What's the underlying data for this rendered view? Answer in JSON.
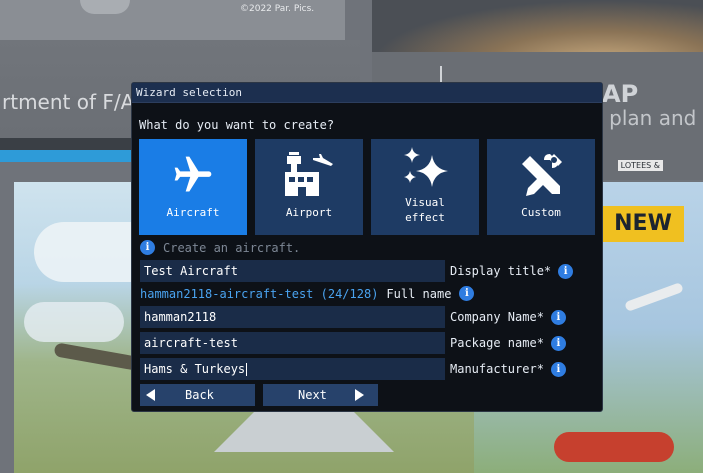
{
  "background": {
    "copyright": "©2022 Par. Pics.",
    "department_text": "rtment of F/A",
    "plan_title": "AP",
    "plan_subtitle": "Create a flight plan and",
    "new_badge": "NEW",
    "sticker": "LOTEES &"
  },
  "dialog": {
    "title": "Wizard selection",
    "question": "What do you want to create?",
    "tiles": [
      {
        "label": "Aircraft",
        "icon": "airplane-icon",
        "selected": true
      },
      {
        "label": "Airport",
        "icon": "airport-icon",
        "selected": false
      },
      {
        "label": "Visual\neffect",
        "icon": "sparkles-icon",
        "selected": false
      },
      {
        "label": "Custom",
        "icon": "tools-icon",
        "selected": false
      }
    ],
    "hint": "Create an aircraft.",
    "fields": {
      "display_title": {
        "value": "Test Aircraft",
        "label": "Display title*"
      },
      "full_name": {
        "value": "hamman2118-aircraft-test (24/128)",
        "label": "Full name"
      },
      "company_name": {
        "value": "hamman2118",
        "label": "Company Name*"
      },
      "package_name": {
        "value": "aircraft-test",
        "label": "Package name*"
      },
      "manufacturer": {
        "value": "Hams & Turkeys",
        "label": "Manufacturer*"
      }
    },
    "buttons": {
      "back": "Back",
      "next": "Next"
    }
  },
  "colors": {
    "dialog_bg": "#0d1117",
    "titlebar": "#1c2f4f",
    "tile": "#1e3b64",
    "tile_selected": "#1a7de6",
    "field_bg": "#1a2c48",
    "info_icon": "#2f7de1",
    "link": "#4aa3f0"
  }
}
